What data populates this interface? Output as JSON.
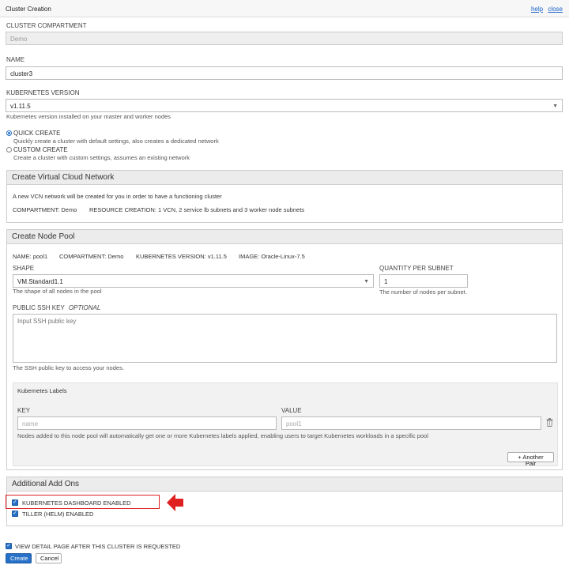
{
  "window": {
    "title": "Cluster Creation",
    "help": "help",
    "close": "close"
  },
  "compartment": {
    "label": "CLUSTER COMPARTMENT",
    "value": "Demo"
  },
  "name": {
    "label": "NAME",
    "value": "cluster3"
  },
  "k8s_version": {
    "label": "KUBERNETES VERSION",
    "value": "v1.11.5",
    "hint": "Kubernetes version installed on your master and worker nodes"
  },
  "create_mode": {
    "quick": {
      "label": "QUICK CREATE",
      "desc": "Quickly create a cluster with default settings, also creates a dedicated network"
    },
    "custom": {
      "label": "CUSTOM CREATE",
      "desc": "Create a cluster with custom settings, assumes an existing network"
    }
  },
  "vcn": {
    "title": "Create Virtual Cloud Network",
    "desc": "A new VCN network will be created for you in order to have a functioning cluster",
    "compartment": "COMPARTMENT: Demo",
    "resources": "RESOURCE CREATION: 1 VCN, 2 service lb subnets and 3 worker node subnets"
  },
  "node_pool": {
    "title": "Create Node Pool",
    "summary": {
      "name": "NAME: pool1",
      "compartment": "COMPARTMENT: Demo",
      "version": "KUBERNETES VERSION: v1.11.5",
      "image": "IMAGE: Oracle-Linux-7.5"
    },
    "shape": {
      "label": "SHAPE",
      "value": "VM.Standard1.1",
      "hint": "The shape of all nodes in the pool"
    },
    "quantity": {
      "label": "QUANTITY PER SUBNET",
      "value": "1",
      "hint": "The number of nodes per subnet."
    },
    "ssh": {
      "label": "PUBLIC SSH KEY",
      "optional": "OPTIONAL",
      "placeholder": "Input SSH public key",
      "hint": "The SSH public key to access your nodes."
    },
    "labels": {
      "title": "Kubernetes Labels",
      "key_label": "KEY",
      "value_label": "VALUE",
      "key_placeholder": "name",
      "value_placeholder": "pool1",
      "hint": "Nodes added to this node pool will automatically get one or more Kubernetes labels applied, enabling users to target Kubernetes workloads in a specific pool",
      "add_pair": "+ Another Pair"
    }
  },
  "addons": {
    "title": "Additional Add Ons",
    "dashboard": "KUBERNETES DASHBOARD ENABLED",
    "tiller": "TILLER (HELM) ENABLED"
  },
  "footer": {
    "view_detail": "VIEW DETAIL PAGE AFTER THIS CLUSTER IS REQUESTED",
    "create": "Create",
    "cancel": "Cancel"
  },
  "colors": {
    "accent": "#2670c7",
    "annotation": "#dd2222"
  },
  "icons": {
    "select_arrow": "chevron-down-icon",
    "trash": "trash-icon",
    "annotation": "arrow-left-icon"
  }
}
